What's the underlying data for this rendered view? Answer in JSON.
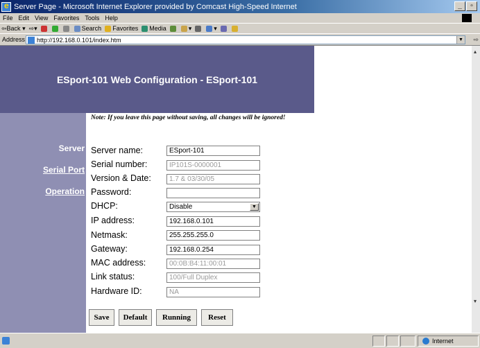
{
  "window": {
    "title": "Server Page - Microsoft Internet Explorer provided by Comcast High-Speed Internet",
    "minimize_glyph": "_",
    "maximize_glyph": "▫"
  },
  "menu": [
    "File",
    "Edit",
    "View",
    "Favorites",
    "Tools",
    "Help"
  ],
  "toolbar": {
    "back": "Back",
    "search": "Search",
    "favorites": "Favorites",
    "media": "Media"
  },
  "address": {
    "label": "Address",
    "url": "http://192.168.0.101/index.htm"
  },
  "page": {
    "header_title": "ESport-101 Web Configuration - ESport-101",
    "note": "Note: If you leave this page without saving, all changes will be ignored!",
    "nav": [
      {
        "label": "Server"
      },
      {
        "label": "Serial Port"
      },
      {
        "label": "Operation"
      }
    ],
    "form": {
      "server_name": {
        "label": "Server name:",
        "value": "ESport-101"
      },
      "serial_number": {
        "label": "Serial number:",
        "value": "IP101S-0000001"
      },
      "version_date": {
        "label": "Version & Date:",
        "value": "1.7 & 03/30/05"
      },
      "password": {
        "label": "Password:",
        "value": ""
      },
      "dhcp": {
        "label": "DHCP:",
        "value": "Disable"
      },
      "ip_address": {
        "label": "IP address:",
        "value": "192.168.0.101"
      },
      "netmask": {
        "label": "Netmask:",
        "value": "255.255.255.0"
      },
      "gateway": {
        "label": "Gateway:",
        "value": "192.168.0.254"
      },
      "mac_address": {
        "label": "MAC address:",
        "value": "00:0B:B4:11:00:01"
      },
      "link_status": {
        "label": "Link status:",
        "value": "100/Full Duplex"
      },
      "hardware_id": {
        "label": "Hardware ID:",
        "value": "NA"
      }
    },
    "buttons": {
      "save": "Save",
      "default": "Default",
      "running": "Running",
      "reset": "Reset"
    }
  },
  "status": {
    "zone": "Internet"
  },
  "colors": {
    "header_band": "#5a5a8a",
    "sidebar": "#8f8fb3"
  }
}
